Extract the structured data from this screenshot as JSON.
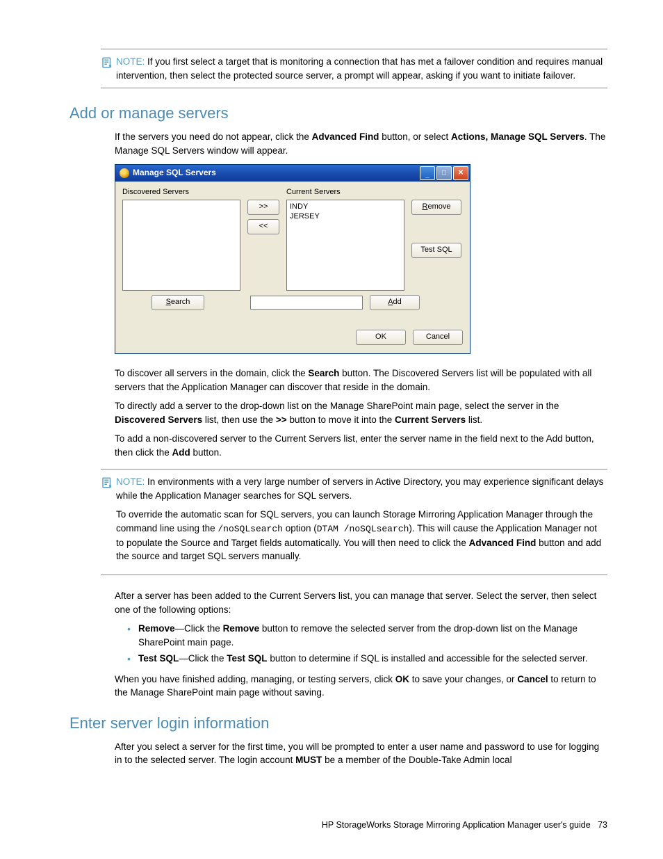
{
  "note1": {
    "label": "NOTE:",
    "text": "If you first select a target that is monitoring a connection that has met a failover condition and requires manual intervention, then select the protected source server, a prompt will appear, asking if you want to initiate failover."
  },
  "section1_title": "Add or manage servers",
  "p1a": "If the servers you need do not appear, click the ",
  "p1b": "Advanced Find",
  "p1c": " button, or select ",
  "p1d": "Actions, Manage SQL Servers",
  "p1e": ". The Manage SQL Servers window will appear.",
  "dialog": {
    "title": "Manage SQL Servers",
    "labels": {
      "discovered": "Discovered Servers",
      "current": "Current Servers"
    },
    "current_items": [
      "INDY",
      "JERSEY"
    ],
    "buttons": {
      "move_right": ">>",
      "move_left": "<<",
      "remove": "Remove",
      "test": "Test SQL",
      "search": "Search",
      "add": "Add",
      "ok": "OK",
      "cancel": "Cancel"
    }
  },
  "p2a": "To discover all servers in the domain, click the ",
  "p2b": "Search",
  "p2c": " button. The Discovered Servers list will be populated with all servers that the Application Manager can discover that reside in the domain.",
  "p3a": "To directly add a server to the drop-down list on the Manage SharePoint main page, select the server in the ",
  "p3b": "Discovered Servers",
  "p3c": " list, then use the ",
  "p3d": ">>",
  "p3e": " button to move it into the ",
  "p3f": "Current Servers",
  "p3g": " list.",
  "p4a": "To add a non-discovered server to the Current Servers list, enter the server name in the field next to the Add button, then click the ",
  "p4b": "Add",
  "p4c": " button.",
  "note2": {
    "label": "NOTE:",
    "n2a": "In environments with a very large number of servers in Active Directory, you may experience significant delays while the Application Manager searches for SQL servers.",
    "n2b_a": "To override the automatic scan for SQL servers, you can launch Storage Mirroring Application Manager through the command line using the ",
    "n2b_code1": "/noSQLsearch",
    "n2b_b": " option (",
    "n2b_code2": "DTAM /noSQLsearch",
    "n2b_c": "). This will cause the Application Manager not to populate the Source and Target fields automatically. You will then need to click the ",
    "n2b_d": "Advanced Find",
    "n2b_e": " button and add the source and target SQL servers manually."
  },
  "p5": "After a server has been added to the Current Servers list, you can manage that server. Select the server, then select one of the following options:",
  "bullets": {
    "b1": {
      "a": "Remove",
      "b": "—Click the ",
      "c": "Remove",
      "d": " button to remove the selected server from the drop-down list on the Manage SharePoint main page."
    },
    "b2": {
      "a": "Test SQL",
      "b": "—Click the ",
      "c": "Test SQL",
      "d": " button to determine if SQL is installed and accessible for the selected server."
    }
  },
  "p6a": "When you have finished adding, managing, or testing servers, click ",
  "p6b": "OK",
  "p6c": " to save your changes, or ",
  "p6d": "Cancel",
  "p6e": " to return to the Manage SharePoint main page without saving.",
  "section2_title": "Enter server login information",
  "p7a": "After you select a server for the first time, you will be prompted to enter a user name and password to use for logging in to the selected server. The login account ",
  "p7b": "MUST",
  "p7c": " be a member of the Double-Take Admin local",
  "footer": {
    "text": "HP StorageWorks Storage Mirroring Application Manager user's guide",
    "page": "73"
  }
}
